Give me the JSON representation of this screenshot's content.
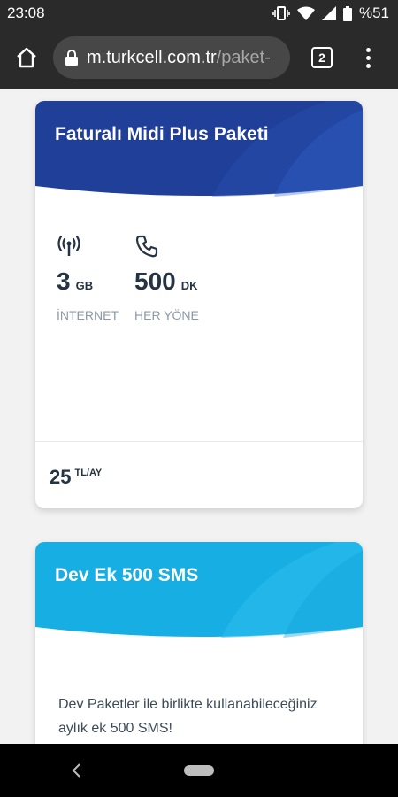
{
  "status_bar": {
    "time": "23:08",
    "battery": "%51"
  },
  "browser": {
    "url_domain": "m.turkcell.com.tr",
    "url_path": "/paket-",
    "tab_count": "2"
  },
  "cards": [
    {
      "title": "Faturalı Midi Plus Paketi",
      "header_color": "#1f3f99",
      "features": [
        {
          "icon": "signal-tower-icon",
          "value": "3",
          "unit": "GB",
          "label": "İNTERNET"
        },
        {
          "icon": "phone-icon",
          "value": "500",
          "unit": "DK",
          "label": "HER YÖNE"
        }
      ],
      "price": {
        "value": "25",
        "unit": "TL/AY"
      }
    },
    {
      "title": "Dev Ek 500 SMS",
      "header_color": "#16aee3",
      "description": "Dev Paketler ile birlikte kullanabileceğiniz aylık ek 500 SMS!"
    }
  ]
}
